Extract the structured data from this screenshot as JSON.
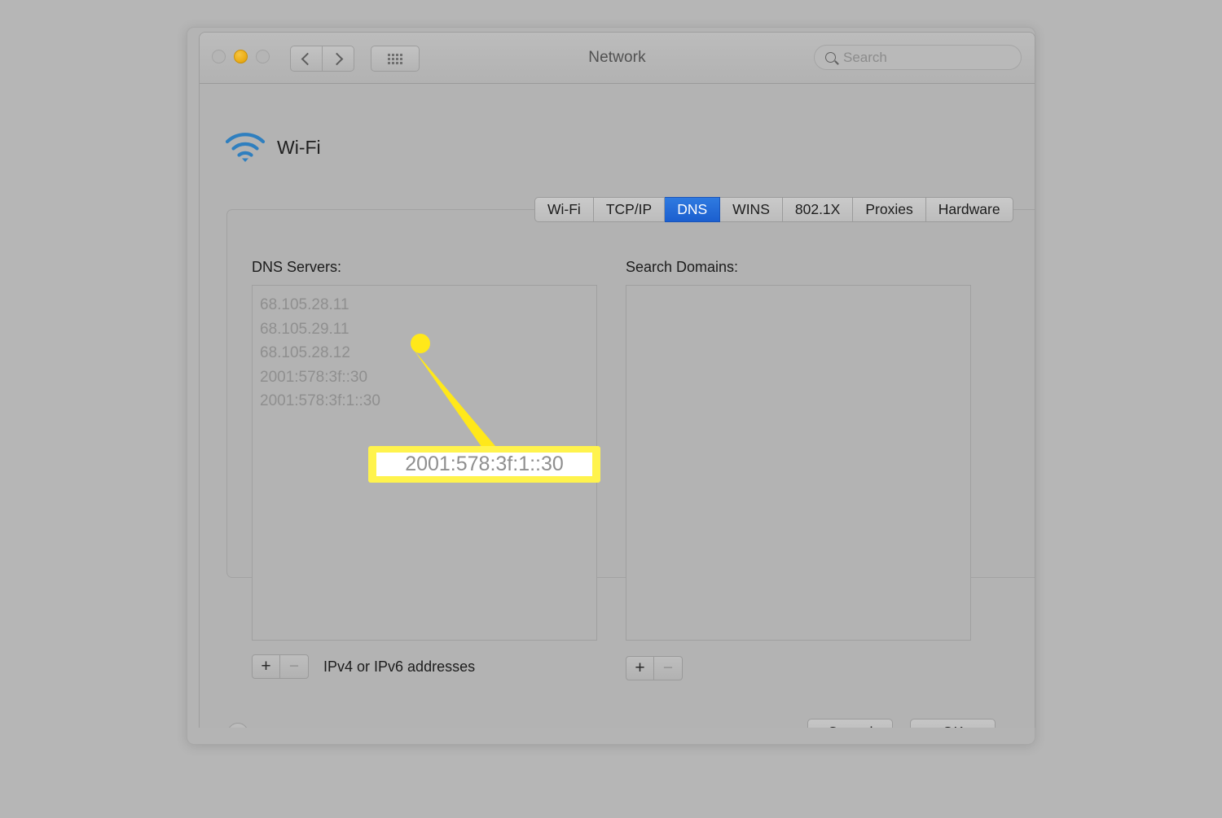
{
  "window": {
    "title": "Network",
    "traffic_lights": [
      {
        "name": "close",
        "state": "inactive"
      },
      {
        "name": "minimize",
        "state": "active",
        "color": "#edb01c"
      },
      {
        "name": "zoom",
        "state": "inactive"
      }
    ],
    "nav": {
      "back_icon": "chevron-left-icon",
      "forward_icon": "chevron-right-icon",
      "show_all_icon": "grid-icon"
    }
  },
  "search": {
    "placeholder": "Search",
    "value": "",
    "icon": "search-icon"
  },
  "service": {
    "name": "Wi-Fi",
    "icon": "wifi-icon"
  },
  "tabs": [
    {
      "label": "Wi-Fi",
      "selected": false
    },
    {
      "label": "TCP/IP",
      "selected": false
    },
    {
      "label": "DNS",
      "selected": true
    },
    {
      "label": "WINS",
      "selected": false
    },
    {
      "label": "802.1X",
      "selected": false
    },
    {
      "label": "Proxies",
      "selected": false
    },
    {
      "label": "Hardware",
      "selected": false
    }
  ],
  "dns_panel": {
    "servers_label": "DNS Servers:",
    "servers": [
      "68.105.28.11",
      "68.105.29.11",
      "68.105.28.12",
      "2001:578:3f::30",
      "2001:578:3f:1::30"
    ],
    "add_label": "+",
    "remove_label": "−",
    "hint": "IPv4 or IPv6 addresses",
    "search_domains_label": "Search Domains:",
    "search_domains": [],
    "domains_add_label": "+",
    "domains_remove_label": "−"
  },
  "footer": {
    "help_label": "?",
    "cancel_label": "Cancel",
    "ok_label": "OK"
  },
  "annotation": {
    "callout_text": "2001:578:3f:1::30",
    "highlight_color": "#fff34d",
    "pointer_color": "#ffe81a"
  },
  "colors": {
    "desktop_background": "#b6b6b6",
    "window_background": "#b3b3b3",
    "selected_tab": "#1b5fcf",
    "dimmed_text": "#8f8f8f",
    "wifi_icon": "#2f7fbf"
  }
}
